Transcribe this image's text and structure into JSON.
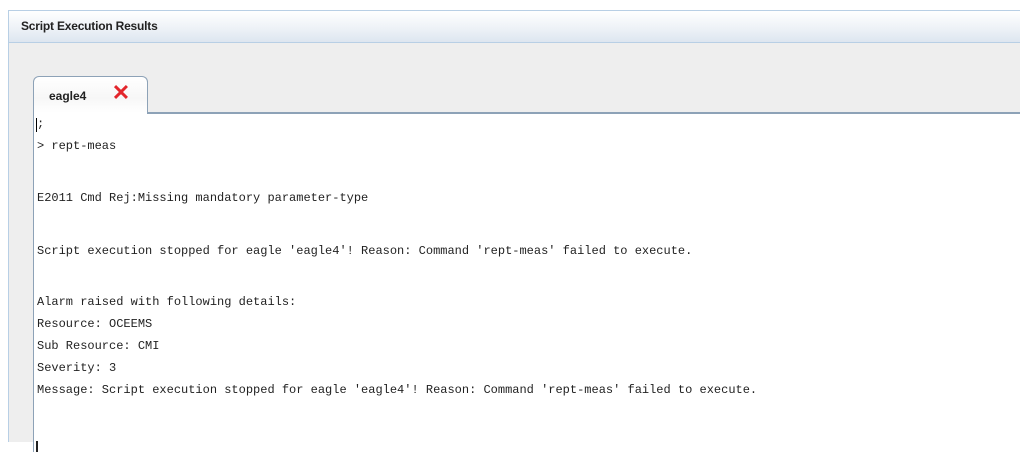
{
  "panel": {
    "title": "Script Execution Results"
  },
  "tabs": [
    {
      "label": "eagle4",
      "close_icon": "close-icon",
      "selected": true
    }
  ],
  "console": {
    "lines": [
      ";",
      "> rept-meas",
      "",
      "E2011 Cmd Rej:Missing mandatory parameter-type",
      "",
      "Script execution stopped for eagle 'eagle4'! Reason: Command 'rept-meas' failed to execute.",
      "",
      "Alarm raised with following details:",
      "Resource: OCEEMS",
      "Sub Resource: CMI",
      "Severity: 3",
      "Message: Script execution stopped for eagle 'eagle4'! Reason: Command 'rept-meas' failed to execute."
    ]
  },
  "colors": {
    "close_icon": "#e3262c",
    "border": "#8da2b7",
    "header_border": "#b8cfe5"
  }
}
